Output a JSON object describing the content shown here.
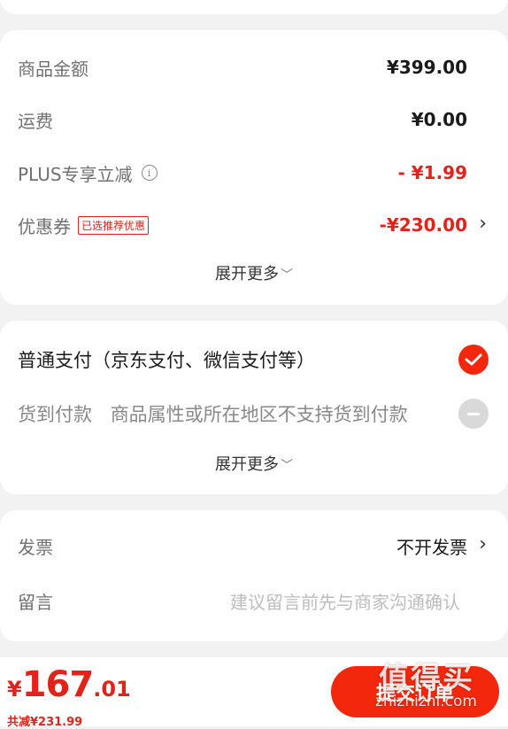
{
  "amounts": {
    "goods_label": "商品金额",
    "goods_value": "¥399.00",
    "shipping_label": "运费",
    "shipping_value": "¥0.00",
    "plus_label": "PLUS专享立减",
    "plus_value": "- ¥1.99",
    "coupon_label": "优惠券",
    "coupon_tag": "已选推荐优惠",
    "coupon_value": "-¥230.00",
    "expand_label": "展开更多"
  },
  "payment": {
    "online_label": "普通支付（京东支付、微信支付等）",
    "cod_label": "货到付款",
    "cod_note": "商品属性或所在地区不支持货到付款",
    "expand_label": "展开更多"
  },
  "invoice": {
    "label": "发票",
    "value": "不开发票",
    "memo_label": "留言",
    "memo_placeholder": "建议留言前先与商家沟通确认"
  },
  "bottom": {
    "currency": "¥",
    "total_int": "167",
    "total_dec": ".01",
    "saving": "共减¥231.99",
    "submit_label": "提交订单"
  },
  "watermark": {
    "logo": "值得买",
    "url": "zhizhizhi.com"
  },
  "colors": {
    "accent": "#f2270c",
    "price_red": "#e2231a"
  }
}
